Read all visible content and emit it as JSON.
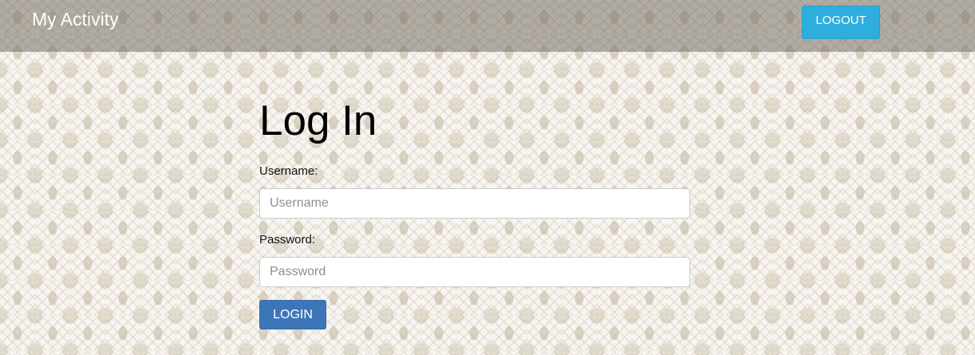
{
  "navbar": {
    "brand": "My Activity",
    "logout_label": "LOGOUT"
  },
  "form": {
    "title": "Log In",
    "username_label": "Username:",
    "username_placeholder": "Username",
    "username_value": "",
    "password_label": "Password:",
    "password_placeholder": "Password",
    "password_value": "",
    "login_label": "LOGIN"
  },
  "colors": {
    "navbar_bg": "#b1aca4",
    "logout_button": "#2eaedc",
    "login_button": "#3d76b8",
    "page_bg": "#f7f5f1"
  }
}
